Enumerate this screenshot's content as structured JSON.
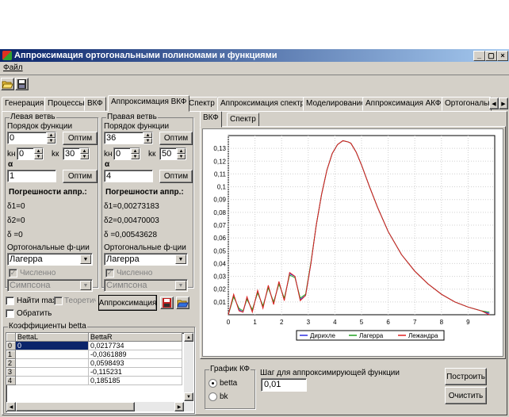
{
  "window": {
    "title": "Аппроксимация ортогональными полиномами и функциями",
    "min": "_",
    "max": "▢",
    "close": "×"
  },
  "menu": {
    "file": "Файл"
  },
  "tabs": [
    "Генерация",
    "Процессы",
    "ВКФ",
    "Аппроксимация ВКФ",
    "Спектр",
    "Аппроксимация спектра",
    "Моделирование",
    "Аппроксимация АКФ",
    "Ортогональн"
  ],
  "left_branch": {
    "title": "Левая ветвь",
    "order_label": "Порядок функции",
    "order_value": "0",
    "optim": "Оптим",
    "kn_label": "kн",
    "kn_value": "0",
    "kk_label": "kк",
    "kk_value": "30",
    "alpha_label": "α",
    "alpha_value": "1",
    "optim2": "Оптим",
    "errors_title": "Погрешности аппр.:",
    "d1": "δ1=0",
    "d2": "δ2=0",
    "d": "δ =0",
    "orth_label": "Ортогональные ф-ции",
    "orth_value": "Лагерра",
    "numeric": "Численно",
    "method": "Симпсона"
  },
  "right_branch": {
    "title": "Правая ветвь",
    "order_label": "Порядок функции",
    "order_value": "36",
    "optim": "Оптим",
    "kn_label": "kн",
    "kn_value": "0",
    "kk_label": "kк",
    "kk_value": "50",
    "alpha_label": "α",
    "alpha_value": "4",
    "optim2": "Оптим",
    "errors_title": "Погрешности аппр.:",
    "d1": "δ1=0,00273183",
    "d2": "δ2=0,00470003",
    "d": "δ =0,00543628",
    "orth_label": "Ортогональные ф-ции",
    "orth_value": "Лагерра",
    "numeric": "Численно",
    "method": "Симпсона"
  },
  "options": {
    "find_max": "Найти max",
    "theoretic": "Теоретич",
    "invert": "Обратить",
    "approx_button": "Аппроксимация"
  },
  "coef": {
    "title": "Коэффициенты betta",
    "headers": [
      "BettaL",
      "BettaR"
    ],
    "rows": [
      {
        "i": "0",
        "l": "0",
        "r": "0,0217734"
      },
      {
        "i": "1",
        "l": "",
        "r": "-0,0361889"
      },
      {
        "i": "2",
        "l": "",
        "r": "0,0598493"
      },
      {
        "i": "3",
        "l": "",
        "r": "-0,115231"
      },
      {
        "i": "4",
        "l": "",
        "r": "0,185185"
      }
    ]
  },
  "chart_tabs": [
    "ВКФ",
    "Спектр"
  ],
  "chart_data": {
    "type": "line",
    "xlim": [
      0,
      10
    ],
    "ylim": [
      0,
      0.14
    ],
    "x_ticks": [
      "0",
      "1",
      "2",
      "3",
      "4",
      "5",
      "6",
      "7",
      "8",
      "9"
    ],
    "y_ticks": [
      "0,01",
      "0,02",
      "0,03",
      "0,04",
      "0,05",
      "0,06",
      "0,07",
      "0,08",
      "0,09",
      "0,1",
      "0,11",
      "0,12",
      "0,13"
    ],
    "grid": true,
    "legend": "bottom",
    "x": [
      0,
      0.2,
      0.4,
      0.55,
      0.7,
      0.9,
      1.1,
      1.3,
      1.5,
      1.7,
      1.9,
      2.1,
      2.3,
      2.5,
      2.7,
      2.9,
      3.1,
      3.3,
      3.5,
      3.7,
      3.9,
      4.1,
      4.3,
      4.5,
      4.6,
      4.8,
      5.0,
      5.3,
      5.6,
      6.0,
      6.5,
      7.0,
      7.5,
      8.0,
      8.5,
      9.0,
      9.5,
      9.8
    ],
    "series": [
      {
        "name": "Дирихле",
        "color": "#3030e0",
        "values": [
          0,
          0.015,
          0.004,
          0.002,
          0.013,
          0.003,
          0.018,
          0.006,
          0.022,
          0.009,
          0.025,
          0.012,
          0.032,
          0.03,
          0.012,
          0.015,
          0.04,
          0.07,
          0.094,
          0.113,
          0.126,
          0.133,
          0.136,
          0.135,
          0.134,
          0.127,
          0.117,
          0.1,
          0.084,
          0.065,
          0.047,
          0.034,
          0.024,
          0.016,
          0.01,
          0.006,
          0.003,
          0.001
        ]
      },
      {
        "name": "Лагерра",
        "color": "#20a020",
        "values": [
          0,
          0.014,
          0.005,
          0.003,
          0.012,
          0.004,
          0.017,
          0.007,
          0.021,
          0.01,
          0.024,
          0.013,
          0.031,
          0.029,
          0.013,
          0.016,
          0.041,
          0.07,
          0.094,
          0.113,
          0.126,
          0.133,
          0.136,
          0.135,
          0.134,
          0.127,
          0.117,
          0.1,
          0.084,
          0.065,
          0.047,
          0.034,
          0.024,
          0.016,
          0.01,
          0.006,
          0.003,
          0.002
        ]
      },
      {
        "name": "Лежандра",
        "color": "#e02020",
        "values": [
          0,
          0.016,
          0.003,
          0.002,
          0.014,
          0.002,
          0.019,
          0.005,
          0.023,
          0.008,
          0.026,
          0.011,
          0.033,
          0.03,
          0.011,
          0.015,
          0.04,
          0.07,
          0.094,
          0.113,
          0.126,
          0.133,
          0.136,
          0.135,
          0.134,
          0.127,
          0.117,
          0.1,
          0.084,
          0.065,
          0.047,
          0.034,
          0.024,
          0.016,
          0.01,
          0.006,
          0.003,
          0.0
        ]
      }
    ]
  },
  "bottom": {
    "graph_title": "График КФ",
    "radio_betta": "betta",
    "radio_bk": "bk",
    "step_label": "Шаг для аппроксимирующей функции",
    "step_value": "0,01",
    "build": "Построить",
    "clear": "Очистить"
  }
}
